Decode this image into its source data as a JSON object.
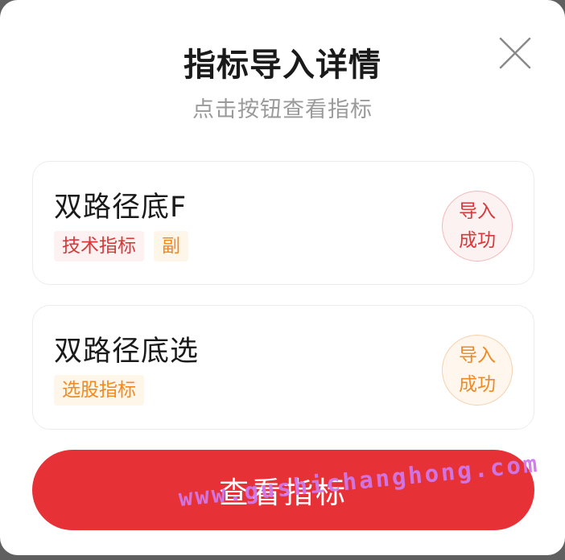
{
  "dialog": {
    "title": "指标导入详情",
    "subtitle": "点击按钮查看指标",
    "close_icon": "close-icon"
  },
  "indicators": [
    {
      "name": "双路径底F",
      "tags": [
        {
          "label": "技术指标",
          "color": "#d7383a"
        },
        {
          "label": "副",
          "color": "#ef8a22"
        }
      ],
      "status_line1": "导入",
      "status_line2": "成功",
      "status_color": "#d7383a"
    },
    {
      "name": "双路径底选",
      "tags": [
        {
          "label": "选股指标",
          "color": "#ef8a22"
        }
      ],
      "status_line1": "导入",
      "status_line2": "成功",
      "status_color": "#ef8a22"
    }
  ],
  "actions": {
    "view_label": "查看指标",
    "accent": "#e63136"
  },
  "watermark": "www.gushichanghong.com"
}
